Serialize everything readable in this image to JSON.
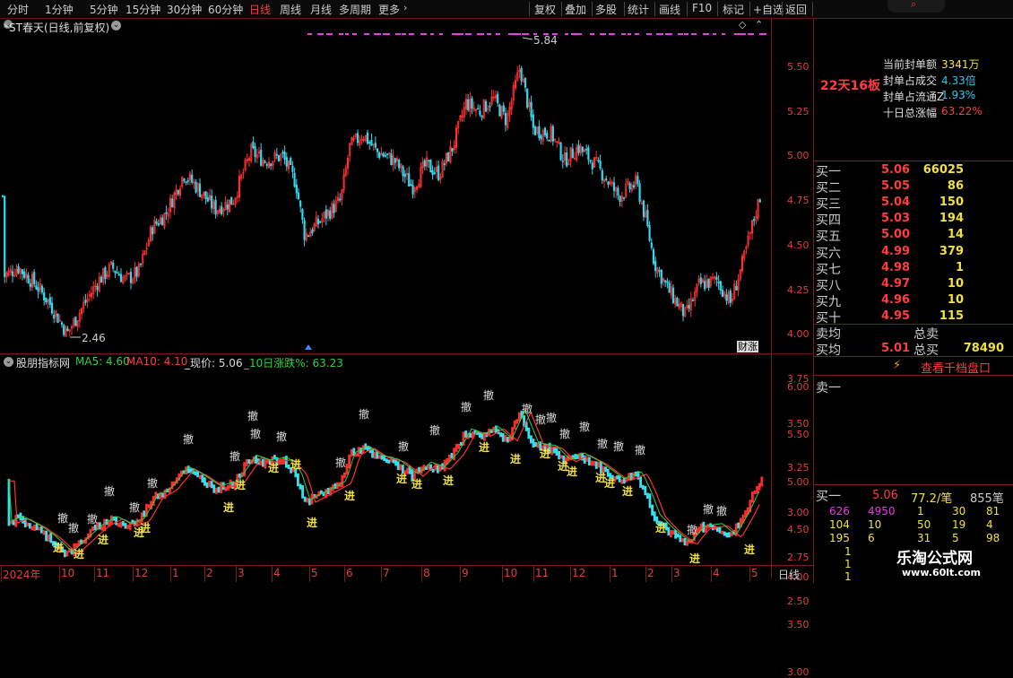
{
  "toolbar": {
    "periods": [
      "分时",
      "1分钟",
      "5分钟",
      "15分钟",
      "30分钟",
      "60分钟",
      "日线",
      "周线",
      "月线",
      "多周期",
      "更多"
    ],
    "active_period": "日线",
    "buttons": [
      "复权",
      "叠加",
      "多股",
      "统计",
      "画线",
      "F10",
      "标记",
      "+自选",
      "返回"
    ],
    "search_icon": "search-icon"
  },
  "main_chart": {
    "title": "*ST春天(日线,前复权)",
    "high_label": "5.84",
    "low_label": "2.46",
    "corner_tag": "财",
    "corner_tag2": "涨",
    "price_axis": [
      "5.50",
      "5.25",
      "5.00",
      "4.75",
      "4.50",
      "4.25",
      "4.00",
      "3.75",
      "3.50",
      "3.25",
      "3.00",
      "2.75",
      "2.50"
    ]
  },
  "sub_chart": {
    "indicator": "股朋指标网",
    "ma5_label": "MA5: 4.60",
    "ma10_label": "MA10: 4.10",
    "price_label": "_现价: 5.06",
    "change_label": "_10日涨跌%: 63.23",
    "axis": [
      "6.00",
      "5.50",
      "5.00",
      "4.50",
      "4.00",
      "3.50",
      "3.00"
    ],
    "sell_mark": "撤",
    "buy_mark": "进",
    "colors": {
      "cyan": "#33e0f0",
      "red": "#ff2a2a",
      "yellow": "#f0e040",
      "green": "#30d040",
      "magenta": "#e040e0"
    }
  },
  "date_axis": [
    "2024年",
    "10",
    "11",
    "12",
    "1",
    "2",
    "3",
    "4",
    "5",
    "6",
    "7",
    "8",
    "9",
    "10",
    "11",
    "12",
    "1",
    "2",
    "3",
    "4",
    "5"
  ],
  "date_axis_period": "日线",
  "right_panel": {
    "limit_up_label": "22天16板",
    "stats": [
      {
        "label": "当前封单额",
        "value": "3341万"
      },
      {
        "label": "封单占成交",
        "value": "4.33倍"
      },
      {
        "label": "封单占流通Z",
        "value": "1.93%"
      },
      {
        "label": "十日总涨幅",
        "value": "63.22%"
      }
    ],
    "bids": [
      {
        "label": "买一",
        "price": "5.06",
        "vol": "66025"
      },
      {
        "label": "买二",
        "price": "5.05",
        "vol": "86"
      },
      {
        "label": "买三",
        "price": "5.04",
        "vol": "150"
      },
      {
        "label": "买四",
        "price": "5.03",
        "vol": "194"
      },
      {
        "label": "买五",
        "price": "5.00",
        "vol": "14"
      },
      {
        "label": "买六",
        "price": "4.99",
        "vol": "379"
      },
      {
        "label": "买七",
        "price": "4.98",
        "vol": "1"
      },
      {
        "label": "买八",
        "price": "4.97",
        "vol": "10"
      },
      {
        "label": "买九",
        "price": "4.96",
        "vol": "10"
      },
      {
        "label": "买十",
        "price": "4.95",
        "vol": "115"
      }
    ],
    "avg_sell_label": "卖均",
    "total_sell_label": "总卖",
    "avg_buy_label": "买均",
    "avg_buy_value": "5.01",
    "total_buy_label": "总买",
    "total_buy_value": "78490",
    "view_depth_button": "查看千档盘口",
    "sell1_label": "卖一",
    "buy1_row": {
      "label": "买一",
      "price": "5.06",
      "per": "77.2/笔",
      "count": "855笔"
    },
    "queue_rows": [
      [
        "626",
        "4950",
        "1",
        "30",
        "81"
      ],
      [
        "104",
        "10",
        "50",
        "19",
        "4"
      ],
      [
        "195",
        "6",
        "31",
        "5",
        "98"
      ]
    ],
    "queue_col": [
      "1",
      "1",
      "1"
    ],
    "watermark_title": "乐淘公式网",
    "watermark_url": "www.60lt.com"
  }
}
